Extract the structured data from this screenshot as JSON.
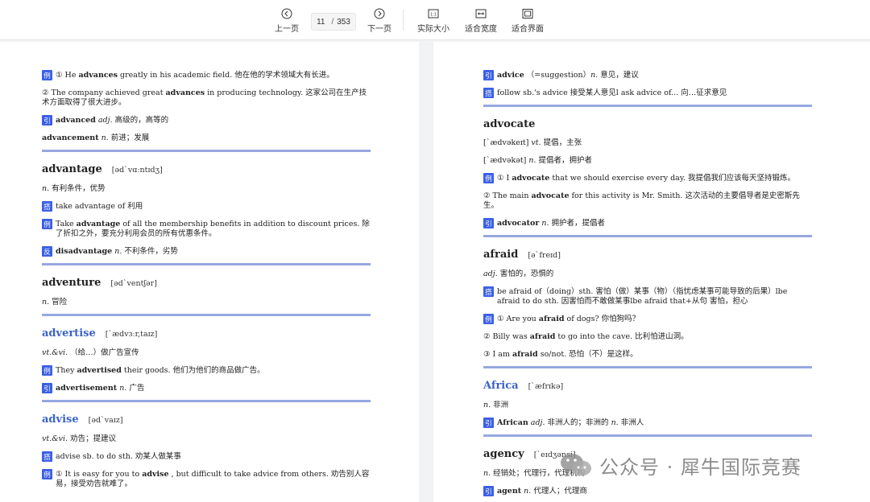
{
  "toolbar": {
    "prev": "上一页",
    "next": "下一页",
    "current_page": "11",
    "page_sep": "/",
    "total_pages": "353",
    "actual_size": "实际大小",
    "actual_size_icon_text": "1:1",
    "fit_width": "适合宽度",
    "fit_page": "适合界面"
  },
  "left": [
    {
      "kind": "line",
      "tag": "例",
      "html": "① He <b>advances</b> greatly in his academic field. 他在他的学术领域大有长进。"
    },
    {
      "kind": "line",
      "tag": "",
      "html": "② The company achieved great <b>advances</b> in producing technology. 这家公司在生产技术方面取得了很大进步。"
    },
    {
      "kind": "line",
      "tag": "引",
      "html": "<b>advanced</b> <i>adj.</i> 高级的，高等的"
    },
    {
      "kind": "line",
      "tag": "",
      "html": "<b>advancement</b> <i>n.</i> 前进；发展"
    },
    {
      "kind": "rule"
    },
    {
      "kind": "head",
      "word": "advantage",
      "phon": "[əd`vɑːntɪdʒ]",
      "blue": false
    },
    {
      "kind": "line",
      "tag": "",
      "html": "<i>n.</i> 有利条件，优势"
    },
    {
      "kind": "line",
      "tag": "搭",
      "html": "take advantage of 利用"
    },
    {
      "kind": "line",
      "tag": "例",
      "html": "Take <b>advantage</b> of all the membership benefits in addition to discount prices. 除了折扣之外，要充分利用会员的所有优惠条件。"
    },
    {
      "kind": "line",
      "tag": "反",
      "html": "<b>disadvantage</b> <i>n.</i> 不利条件，劣势"
    },
    {
      "kind": "rule"
    },
    {
      "kind": "head",
      "word": "adventure",
      "phon": "[əd`ventʃər]",
      "blue": false
    },
    {
      "kind": "line",
      "tag": "",
      "html": "<i>n.</i> 冒险"
    },
    {
      "kind": "rule"
    },
    {
      "kind": "head",
      "word": "advertise",
      "phon": "[`ædvɜːr,taɪz]",
      "blue": true
    },
    {
      "kind": "line",
      "tag": "",
      "html": "<i>vt.&amp;vi.</i> （给…）做广告宣传"
    },
    {
      "kind": "line",
      "tag": "例",
      "html": "They <b>advertised</b> their goods. 他们为他们的商品做广告。"
    },
    {
      "kind": "line",
      "tag": "引",
      "html": "<b>advertisement</b> <i>n.</i> 广告"
    },
    {
      "kind": "rule"
    },
    {
      "kind": "head",
      "word": "advise",
      "phon": "[əd`vaɪz]",
      "blue": true
    },
    {
      "kind": "line",
      "tag": "",
      "html": "<i>vt.&amp;vi.</i> 劝告；提建议"
    },
    {
      "kind": "line",
      "tag": "搭",
      "html": "advise sb. to do sth. 劝某人做某事"
    },
    {
      "kind": "line",
      "tag": "例",
      "html": "① It is easy for you to <b>advise</b> , but difficult to take advice from others. 劝告别人容易，接受劝告就难了。"
    }
  ],
  "right": [
    {
      "kind": "line",
      "tag": "引",
      "html": "<b>advice</b> （=suggestion）<i>n.</i> 意见，建议"
    },
    {
      "kind": "line",
      "tag": "搭",
      "html": "follow sb.'s advice 接受某人意见l ask advice of... 向…征求意见"
    },
    {
      "kind": "rule"
    },
    {
      "kind": "head",
      "word": "advocate",
      "phon": "",
      "blue": false
    },
    {
      "kind": "line",
      "tag": "",
      "html": "[`ædvəkeɪt] <i>vt.</i> 提倡，主张"
    },
    {
      "kind": "line",
      "tag": "",
      "html": "[`ædvəkət] <i>n.</i> 提倡者，拥护者"
    },
    {
      "kind": "line",
      "tag": "例",
      "html": "① I <b>advocate</b> that we should exercise every day. 我提倡我们应该每天坚持锻炼。"
    },
    {
      "kind": "line",
      "tag": "",
      "html": "② The main <b>advocate</b> for this activity is Mr. Smith. 这次活动的主要倡导者是史密斯先生。"
    },
    {
      "kind": "line",
      "tag": "引",
      "html": "<b>advocator</b> <i>n.</i> 拥护者，提倡者"
    },
    {
      "kind": "rule"
    },
    {
      "kind": "head",
      "word": "afraid",
      "phon": "[ə`freɪd]",
      "blue": false
    },
    {
      "kind": "line",
      "tag": "",
      "html": "<i>adj.</i> 害怕的，恐惧的"
    },
    {
      "kind": "line",
      "tag": "搭",
      "html": "be afraid of（doing）sth. 害怕（做）某事（物）（指忧虑某事可能导致的后果）lbe afraid to do sth. 因害怕而不敢做某事lbe afraid that+从句 害怕，担心"
    },
    {
      "kind": "line",
      "tag": "例",
      "html": "① Are you <b>afraid</b> of dogs? 你怕狗吗？"
    },
    {
      "kind": "line",
      "tag": "",
      "html": "② Billy was <b>afraid</b> to go into the cave. 比利怕进山洞。"
    },
    {
      "kind": "line",
      "tag": "",
      "html": "③ I am <b>afraid</b> so/not. 恐怕（不）是这样。"
    },
    {
      "kind": "rule"
    },
    {
      "kind": "head",
      "word": "Africa",
      "phon": "[`æfrɪkə]",
      "blue": true
    },
    {
      "kind": "line",
      "tag": "",
      "html": "<i>n.</i> 非洲"
    },
    {
      "kind": "line",
      "tag": "引",
      "html": "<b>African</b> <i>adj.</i> 非洲人的；非洲的 <i>n.</i> 非洲人"
    },
    {
      "kind": "rule"
    },
    {
      "kind": "head",
      "word": "agency",
      "phon": "[`eɪdʒənsi]",
      "blue": false
    },
    {
      "kind": "line",
      "tag": "",
      "html": "<i>n.</i> 经销处；代理行，代理机构"
    },
    {
      "kind": "line",
      "tag": "引",
      "html": "<b>agent</b> <i>n.</i> 代理人；代理商"
    }
  ],
  "watermark": {
    "text": "公众号 · 犀牛国际竞赛"
  },
  "colors": {
    "tag_bg": "#3b5fe6",
    "rule": "#96a8e0",
    "blue_word": "#3b63c6"
  }
}
